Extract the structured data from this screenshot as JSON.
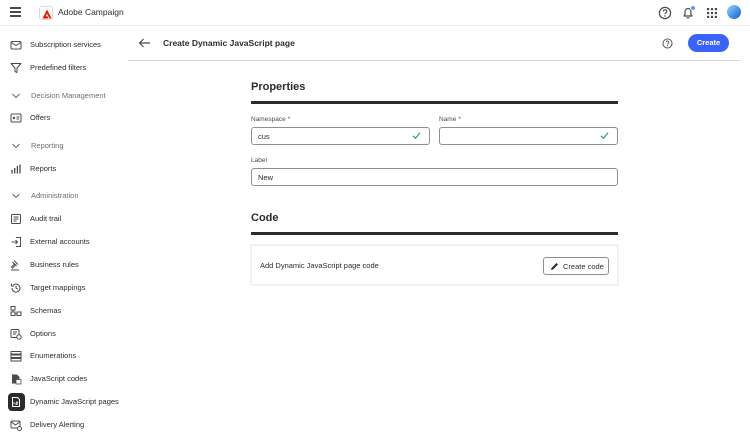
{
  "app": {
    "title": "Adobe Campaign"
  },
  "sidebar": {
    "items": [
      {
        "label": "Subscription services",
        "icon": "envelope-check-icon"
      },
      {
        "label": "Predefined filters",
        "icon": "filter-icon"
      },
      {
        "section": "Decision Management"
      },
      {
        "label": "Offers",
        "icon": "offer-icon"
      },
      {
        "section": "Reporting"
      },
      {
        "label": "Reports",
        "icon": "bar-chart-icon"
      },
      {
        "section": "Administration"
      },
      {
        "label": "Audit trail",
        "icon": "audit-trail-icon"
      },
      {
        "label": "External accounts",
        "icon": "login-icon"
      },
      {
        "label": "Business rules",
        "icon": "gavel-icon"
      },
      {
        "label": "Target mappings",
        "icon": "history-icon"
      },
      {
        "label": "Schemas",
        "icon": "schema-icon"
      },
      {
        "label": "Options",
        "icon": "options-icon"
      },
      {
        "label": "Enumerations",
        "icon": "list-icon"
      },
      {
        "label": "JavaScript codes",
        "icon": "js-code-icon"
      },
      {
        "label": "Dynamic JavaScript pages",
        "icon": "js-page-icon",
        "active": true
      },
      {
        "label": "Delivery Alerting",
        "icon": "delivery-alert-icon"
      }
    ]
  },
  "header": {
    "title": "Create Dynamic JavaScript page",
    "create_label": "Create"
  },
  "properties": {
    "title": "Properties",
    "namespace_label": "Namespace",
    "namespace_value": "cus",
    "name_label": "Name",
    "name_value": "",
    "label_label": "Label",
    "label_value": "New",
    "required_mark": "*"
  },
  "code": {
    "title": "Code",
    "description": "Add Dynamic JavaScript page code",
    "button_label": "Create code"
  },
  "colors": {
    "accent": "#3b63fb",
    "valid": "#2d9d78",
    "text": "#2c2c2c",
    "brand_red": "#eb1000"
  }
}
